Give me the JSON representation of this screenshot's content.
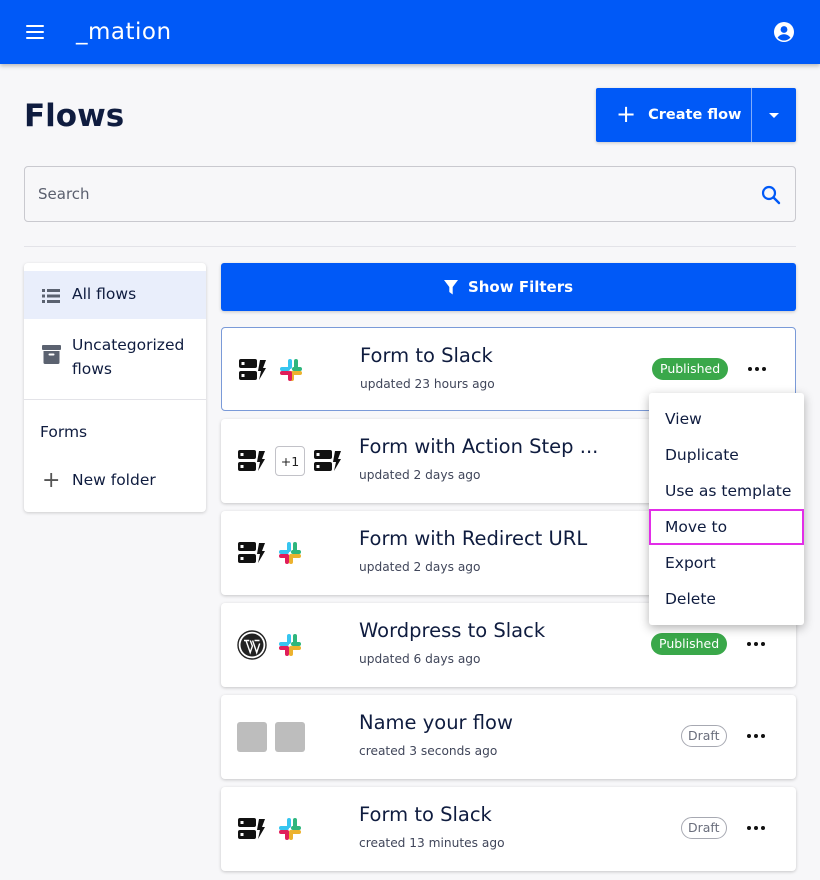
{
  "app": {
    "logo_text": "_mation"
  },
  "page": {
    "title": "Flows",
    "create_label": "Create flow"
  },
  "search": {
    "placeholder": "Search"
  },
  "sidebar": {
    "items": [
      {
        "label": "All flows",
        "icon": "list-icon",
        "selected": true
      },
      {
        "label": "Uncategorized flows",
        "icon": "archive-icon",
        "selected": false
      },
      {
        "label": "Forms",
        "icon": "",
        "selected": false
      },
      {
        "label": "New folder",
        "icon": "plus-icon",
        "selected": false
      }
    ]
  },
  "filters": {
    "label": "Show Filters"
  },
  "flows": [
    {
      "title": "Form to Slack",
      "subtitle": "updated 23 hours ago",
      "status": "Published",
      "icons": [
        "form-icon",
        "slack-icon"
      ]
    },
    {
      "title": "Form with Action Step ...",
      "subtitle": "updated 2 days ago",
      "status": "",
      "icons": [
        "form-icon",
        "+1",
        "form-icon"
      ]
    },
    {
      "title": "Form with Redirect URL",
      "subtitle": "updated 2 days ago",
      "status": "",
      "icons": [
        "form-icon",
        "slack-icon"
      ]
    },
    {
      "title": "Wordpress to Slack",
      "subtitle": "updated 6 days ago",
      "status": "Published",
      "icons": [
        "wordpress-icon",
        "slack-icon"
      ]
    },
    {
      "title": "Name your flow",
      "subtitle": "created 3 seconds ago",
      "status": "Draft",
      "icons": [
        "placeholder-icon",
        "placeholder-icon"
      ]
    },
    {
      "title": "Form to Slack",
      "subtitle": "created 13 minutes ago",
      "status": "Draft",
      "icons": [
        "form-icon",
        "slack-icon"
      ]
    }
  ],
  "context_menu": {
    "items": [
      "View",
      "Duplicate",
      "Use as template",
      "Move to",
      "Export",
      "Delete"
    ],
    "focused": "Move to"
  },
  "colors": {
    "primary": "#0059f7",
    "published": "#3aa84a",
    "focus_outline": "#e22de8"
  }
}
